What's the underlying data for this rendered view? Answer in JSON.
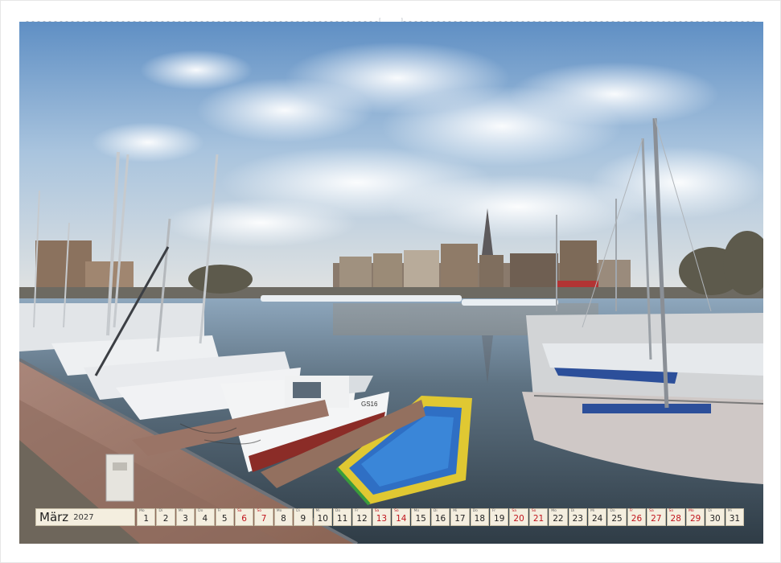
{
  "calendar": {
    "month": "März",
    "year": "2027",
    "days": [
      {
        "n": "1",
        "w": "Mo",
        "weekend": false
      },
      {
        "n": "2",
        "w": "Di",
        "weekend": false
      },
      {
        "n": "3",
        "w": "Mi",
        "weekend": false
      },
      {
        "n": "4",
        "w": "Do",
        "weekend": false
      },
      {
        "n": "5",
        "w": "Fr",
        "weekend": false
      },
      {
        "n": "6",
        "w": "Sa",
        "weekend": true
      },
      {
        "n": "7",
        "w": "So",
        "weekend": true
      },
      {
        "n": "8",
        "w": "Mo",
        "weekend": false
      },
      {
        "n": "9",
        "w": "Di",
        "weekend": false
      },
      {
        "n": "10",
        "w": "Mi",
        "weekend": false
      },
      {
        "n": "11",
        "w": "Do",
        "weekend": false
      },
      {
        "n": "12",
        "w": "Fr",
        "weekend": false
      },
      {
        "n": "13",
        "w": "Sa",
        "weekend": true
      },
      {
        "n": "14",
        "w": "So",
        "weekend": true
      },
      {
        "n": "15",
        "w": "Mo",
        "weekend": false
      },
      {
        "n": "16",
        "w": "Di",
        "weekend": false
      },
      {
        "n": "17",
        "w": "Mi",
        "weekend": false
      },
      {
        "n": "18",
        "w": "Do",
        "weekend": false
      },
      {
        "n": "19",
        "w": "Fr",
        "weekend": false
      },
      {
        "n": "20",
        "w": "Sa",
        "weekend": true
      },
      {
        "n": "21",
        "w": "So",
        "weekend": true
      },
      {
        "n": "22",
        "w": "Mo",
        "weekend": false
      },
      {
        "n": "23",
        "w": "Di",
        "weekend": false
      },
      {
        "n": "24",
        "w": "Mi",
        "weekend": false
      },
      {
        "n": "25",
        "w": "Do",
        "weekend": false
      },
      {
        "n": "26",
        "w": "Fr",
        "weekend": true
      },
      {
        "n": "27",
        "w": "Sa",
        "weekend": true
      },
      {
        "n": "28",
        "w": "So",
        "weekend": true
      },
      {
        "n": "29",
        "w": "Mo",
        "weekend": true
      },
      {
        "n": "30",
        "w": "Di",
        "weekend": false
      },
      {
        "n": "31",
        "w": "Mi",
        "weekend": false
      }
    ]
  },
  "colors": {
    "weekend": "#c0141c",
    "cell_bg": "#f4eedf",
    "water": "#4d5f6d",
    "sky": "#7fa7cf"
  },
  "boat_name": "GS16"
}
